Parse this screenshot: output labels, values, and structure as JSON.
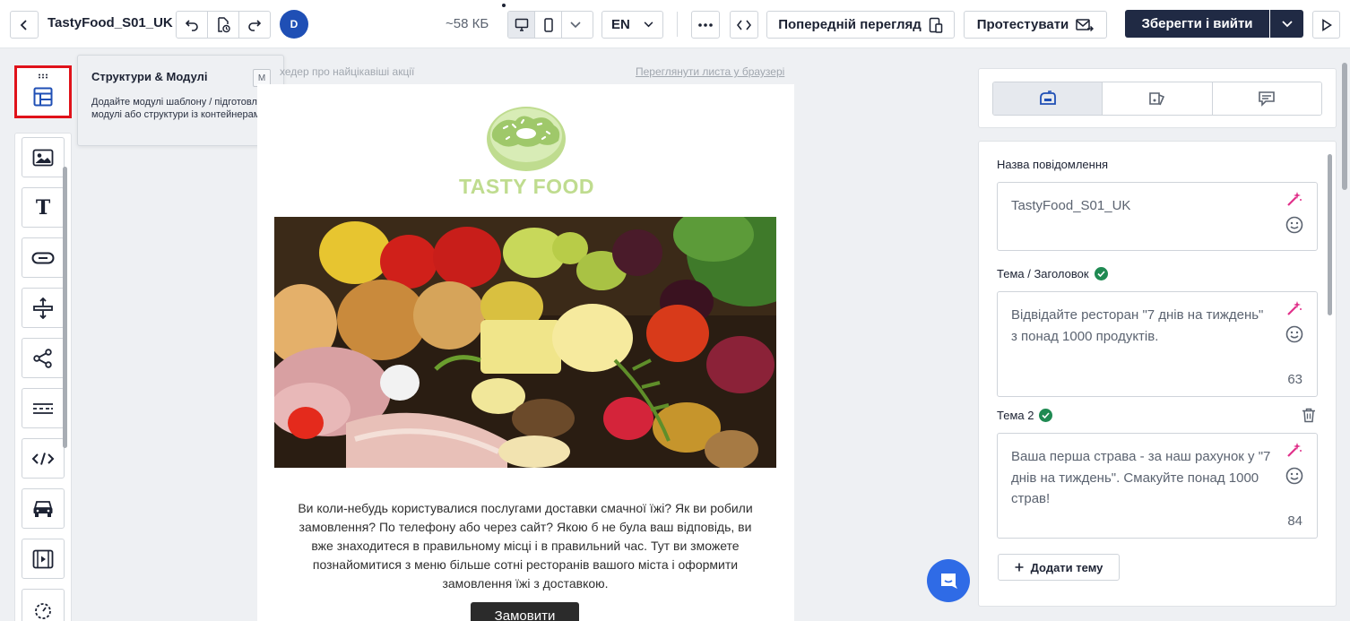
{
  "topbar": {
    "title": "TastyFood_S01_UK",
    "avatar_initial": "D",
    "size_text": "~58 КБ",
    "language": "EN",
    "preview_label": "Попередній перегляд",
    "test_label": "Протестувати",
    "save_exit_label": "Зберегти і вийти"
  },
  "tooltip": {
    "title": "Структури & Модулі",
    "shortcut": "M",
    "description": "Додайте модулі шаблону / підготовлені модулі або структури із контейнерами"
  },
  "email": {
    "preheader": "хедер про найцікавіші акції",
    "browser_link": "Переглянути листа у браузері",
    "logo_text": "TASTY FOOD",
    "body_text": "Ви коли-небудь користувалися послугами доставки смачної їжі? Як ви робили замовлення? По телефону або через сайт? Якою б не була ваш відповідь, ви вже знаходитеся в правильному місці і в правильний час. Тут ви зможете познайомитися з меню більше сотні ресторанів вашого міста і оформити замовлення їжі з доставкою.",
    "order_button": "Замовити"
  },
  "right_panel": {
    "message_name_label": "Назва повідомлення",
    "message_name_value": "TastyFood_S01_UK",
    "subject_label": "Тема / Заголовок",
    "subject_value": "Відвідайте ресторан \"7 днів на тиждень\" з понад 1000 продуктів.",
    "subject_count": "63",
    "subject2_label": "Тема 2",
    "subject2_value": "Ваша перша страва - за наш рахунок у \"7 днів на тиждень\". Смакуйте понад 1000 страв!",
    "subject2_count": "84",
    "add_topic_label": "Додати тему"
  },
  "colors": {
    "highlight": "#e0121a",
    "primary_dark": "#202a44",
    "avatar": "#1f4fb5",
    "check_green": "#1f8a52",
    "magic_pink": "#e0308a",
    "chat_blue": "#2f6be6"
  }
}
